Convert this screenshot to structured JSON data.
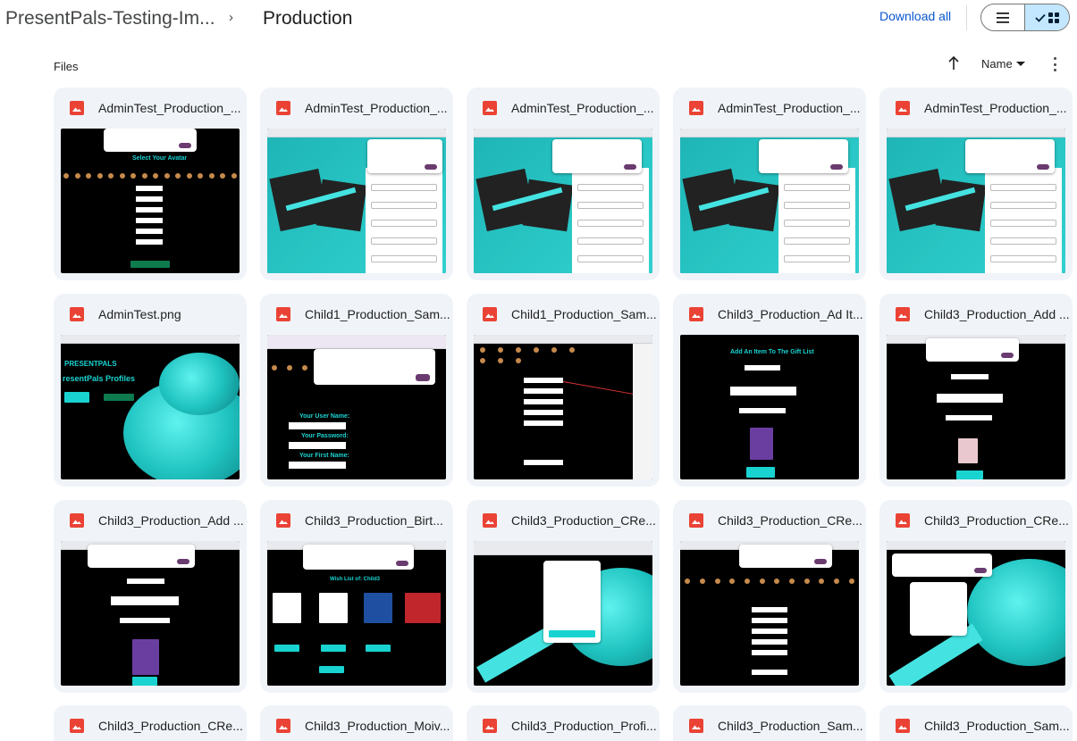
{
  "breadcrumb": {
    "root": "PresentPals-Testing-Im...",
    "separator": "›",
    "current": "Production"
  },
  "header": {
    "download_all": "Download all",
    "view_list_icon": "list-view-icon",
    "view_grid_icon": "grid-view-icon",
    "selected_view": "grid"
  },
  "section": {
    "files_label": "Files",
    "sort_label": "Name"
  },
  "colors": {
    "accent": "#0b57d0",
    "card_bg": "#f0f4f9",
    "image_icon": "#ea4335",
    "selected_toggle": "#c2e7ff"
  },
  "files": [
    {
      "name": "AdminTest_Production_...",
      "icon": "image-file-icon",
      "preview": "avatar-form"
    },
    {
      "name": "AdminTest_Production_...",
      "icon": "image-file-icon",
      "preview": "gift-form"
    },
    {
      "name": "AdminTest_Production_...",
      "icon": "image-file-icon",
      "preview": "gift-form"
    },
    {
      "name": "AdminTest_Production_...",
      "icon": "image-file-icon",
      "preview": "gift-form"
    },
    {
      "name": "AdminTest_Production_...",
      "icon": "image-file-icon",
      "preview": "gift-form"
    },
    {
      "name": "AdminTest.png",
      "icon": "image-file-icon",
      "preview": "profiles"
    },
    {
      "name": "Child1_Production_Sam...",
      "icon": "image-file-icon",
      "preview": "login-dialog"
    },
    {
      "name": "Child1_Production_Sam...",
      "icon": "image-file-icon",
      "preview": "dark-form"
    },
    {
      "name": "Child3_Production_Ad It...",
      "icon": "image-file-icon",
      "preview": "add-item"
    },
    {
      "name": "Child3_Production_Add ...",
      "icon": "image-file-icon",
      "preview": "add-item-dialog"
    },
    {
      "name": "Child3_Production_Add ...",
      "icon": "image-file-icon",
      "preview": "add-item-dialog"
    },
    {
      "name": "Child3_Production_Birt...",
      "icon": "image-file-icon",
      "preview": "wish-list"
    },
    {
      "name": "Child3_Production_CRe...",
      "icon": "image-file-icon",
      "preview": "event-list"
    },
    {
      "name": "Child3_Production_CRe...",
      "icon": "image-file-icon",
      "preview": "avatar-dialog"
    },
    {
      "name": "Child3_Production_CRe...",
      "icon": "image-file-icon",
      "preview": "bow-dialog"
    },
    {
      "name": "Child3_Production_CRe...",
      "icon": "image-file-icon",
      "preview": "none"
    },
    {
      "name": "Child3_Production_Moiv...",
      "icon": "image-file-icon",
      "preview": "none"
    },
    {
      "name": "Child3_Production_Profi...",
      "icon": "image-file-icon",
      "preview": "none"
    },
    {
      "name": "Child3_Production_Sam...",
      "icon": "image-file-icon",
      "preview": "none"
    },
    {
      "name": "Child3_Production_Sam...",
      "icon": "image-file-icon",
      "preview": "none"
    }
  ]
}
